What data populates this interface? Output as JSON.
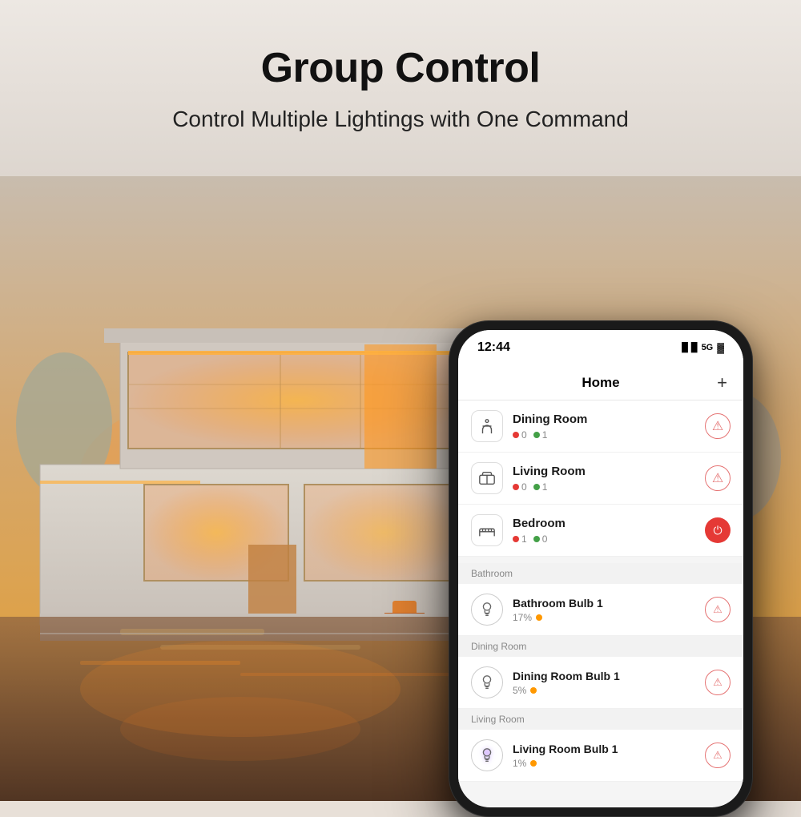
{
  "page": {
    "title": "Group Control",
    "subtitle": "Control Multiple Lightings with One Command"
  },
  "phone": {
    "status_bar": {
      "time": "12:44",
      "signal": "●●●● 5G",
      "battery": "🔋"
    },
    "header": {
      "title": "Home",
      "add_button": "+"
    },
    "rooms": [
      {
        "name": "Dining Room",
        "icon": "🍽",
        "offline_count": "0",
        "online_count": "1",
        "action": "warning"
      },
      {
        "name": "Living Room",
        "icon": "🛋",
        "offline_count": "0",
        "online_count": "1",
        "action": "warning"
      },
      {
        "name": "Bedroom",
        "icon": "🛏",
        "offline_count": "1",
        "online_count": "0",
        "action": "power"
      }
    ],
    "device_sections": [
      {
        "section_name": "Bathroom",
        "devices": [
          {
            "name": "Bathroom Bulb 1",
            "brightness": "17%",
            "color": "orange",
            "action": "warning"
          }
        ]
      },
      {
        "section_name": "Dining Room",
        "devices": [
          {
            "name": "Dining Room Bulb 1",
            "brightness": "5%",
            "color": "orange",
            "action": "warning"
          }
        ]
      },
      {
        "section_name": "Living Room",
        "devices": [
          {
            "name": "Living Room Bulb 1",
            "brightness": "1%",
            "color": "orange",
            "action": "warning"
          }
        ]
      }
    ]
  }
}
